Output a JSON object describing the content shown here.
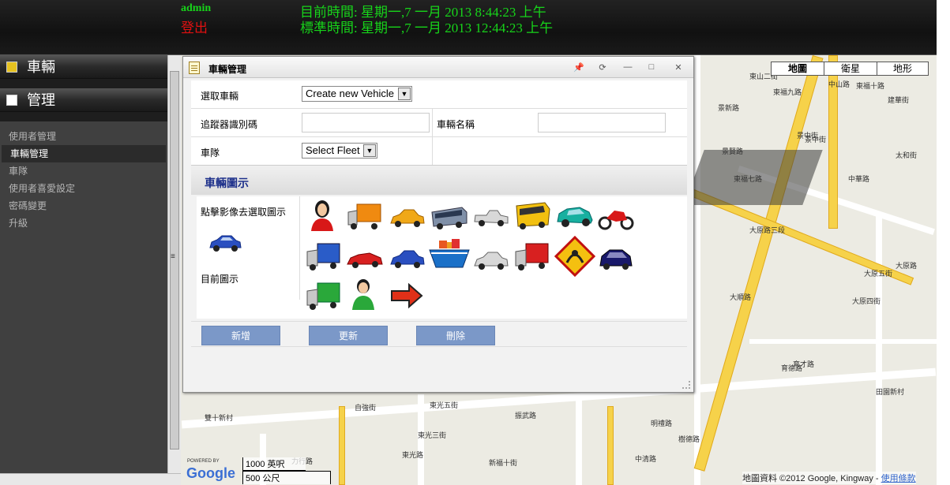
{
  "header": {
    "user": "admin",
    "logout": "登出",
    "current_time": "目前時間: 星期一,7 一月 2013 8:44:23 上午",
    "standard_time": "標準時間: 星期一,7 一月 2013 12:44:23 上午"
  },
  "sidebar": {
    "section1": "車輛",
    "section2": "管理",
    "items": [
      {
        "label": "使用者管理"
      },
      {
        "label": "車輛管理"
      },
      {
        "label": "車隊"
      },
      {
        "label": "使用者喜愛設定"
      },
      {
        "label": "密碼變更"
      },
      {
        "label": "升級"
      }
    ],
    "active_index": 1
  },
  "map": {
    "types": [
      "地圖",
      "衛星",
      "地形"
    ],
    "selected_type": "地圖",
    "attribution": "地圖資料 ©2012 Google, Kingway - ",
    "terms_link": "使用條款",
    "scale_ft": "1000 英呎",
    "scale_m": "500 公尺",
    "powered_by": "POWERED BY",
    "google": "Google",
    "labels": [
      "中山路",
      "東福十路",
      "建華街",
      "東福九路",
      "東福七路",
      "中華路",
      "景賢路",
      "景中街",
      "大原路三段",
      "大原路",
      "大原五街",
      "大原四街",
      "大順路",
      "育才路",
      "雙十新村",
      "力行路",
      "東光五街",
      "東光三街",
      "振武路",
      "新福十街",
      "明禮路",
      "田園新村",
      "東山二街",
      "育德路",
      "景新路",
      "自強街",
      "東光路",
      "中清路",
      "樹德路",
      "太和街",
      "景中街"
    ]
  },
  "dialog": {
    "title": "車輛管理",
    "controls": [
      "📌",
      "⟳",
      "—",
      "□",
      "✕"
    ],
    "select_vehicle_label": "選取車輛",
    "select_vehicle_value": "Create new Vehicle",
    "tracker_id_label": "追蹤器識別碼",
    "tracker_id_value": "",
    "vehicle_name_label": "車輛名稱",
    "vehicle_name_value": "",
    "fleet_label": "車隊",
    "fleet_value": "Select Fleet",
    "icon_section_title": "車輛圖示",
    "click_to_select": "點擊影像去選取圖示",
    "current_icon": "目前圖示",
    "icons": [
      "person-red-icon",
      "truck-orange-icon",
      "car-yellow-icon",
      "bus-icon",
      "pickup-silver-icon",
      "school-bus-icon",
      "car-teal-icon",
      "motorcycle-red-icon",
      "truck-blue-icon",
      "sports-car-red-icon",
      "car-blue-icon",
      "ship-icon",
      "car-silver-icon",
      "truck-red-icon",
      "warning-sign-icon",
      "car-navy-icon",
      "truck-green-icon",
      "person-green-icon",
      "arrow-icon"
    ],
    "buttons": {
      "add": "新增",
      "update": "更新",
      "delete": "刪除"
    }
  },
  "colors": {
    "header_green": "#17d41a",
    "logout_red": "#e01010",
    "button_blue": "#7b98c8",
    "section_title": "#1c2f8a"
  }
}
